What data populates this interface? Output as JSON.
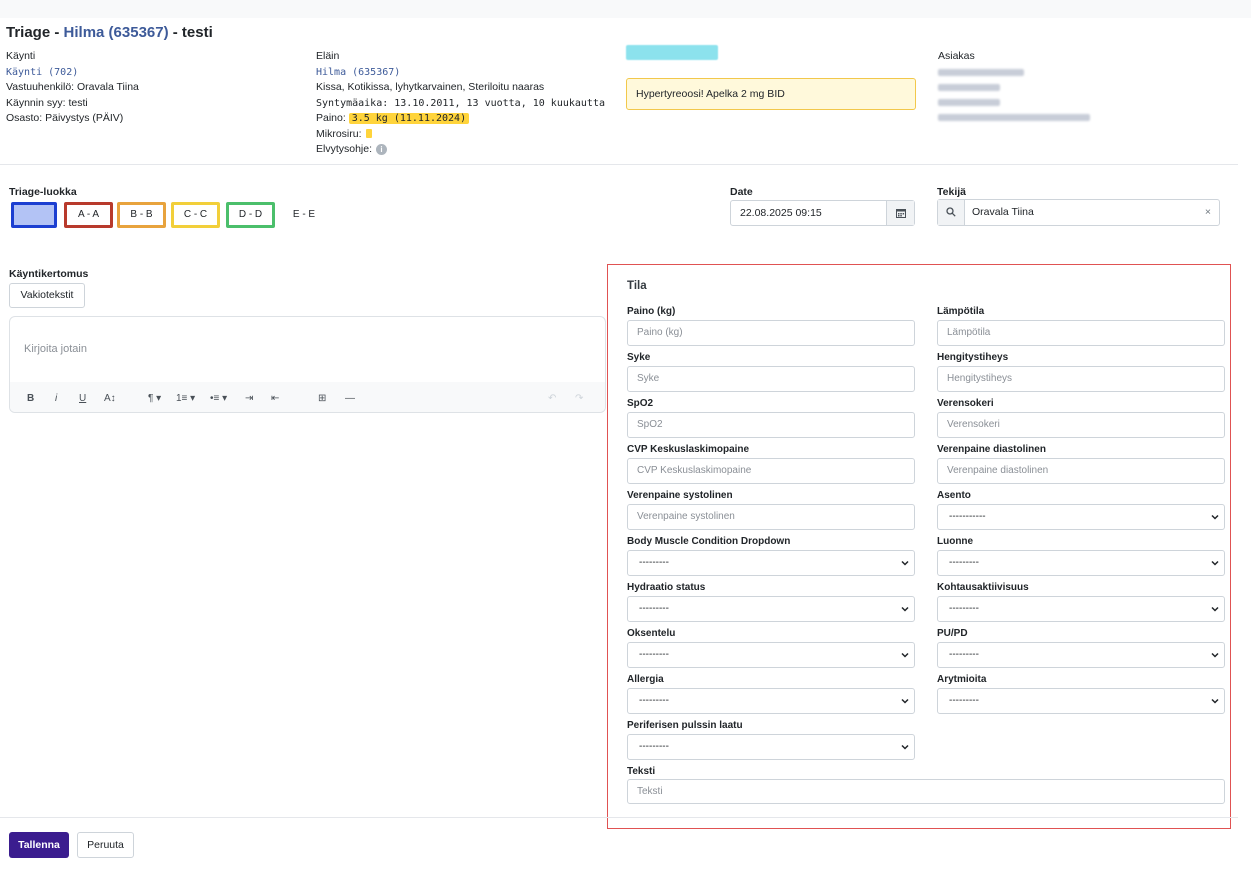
{
  "page": {
    "title_prefix": "Triage - ",
    "title_link": "Hilma (635367)",
    "title_suffix": " - testi"
  },
  "visit": {
    "heading": "Käynti",
    "link": "Käynti (702)",
    "responsible": "Vastuuhenkilö: Oravala Tiina",
    "reason": "Käynnin syy: testi",
    "department": "Osasto: Päivystys (PÄIV)"
  },
  "animal": {
    "heading": "Eläin",
    "link": "Hilma (635367)",
    "description": "Kissa, Kotikissa, lyhytkarvainen, Steriloitu naaras",
    "birthdate": "Syntymäaika: 13.10.2011, 13 vuotta, 10 kuukautta",
    "weight_label": "Paino:",
    "weight_value": "3.5 kg (11.11.2024)",
    "microchip_label": "Mikrosiru:",
    "resuscitation_label": "Elvytysohje:"
  },
  "alert": {
    "text": "Hypertyreoosi! Apelka 2 mg BID"
  },
  "customer": {
    "heading": "Asiakas"
  },
  "triage": {
    "label": "Triage-luokka",
    "options": [
      "",
      "A - A",
      "B - B",
      "C - C",
      "D - D",
      "E - E"
    ],
    "colors": [
      "#1c3fd1",
      "#b83a2c",
      "#e8a33d",
      "#f2cf3a",
      "#4bbf6b",
      "#ffffff"
    ]
  },
  "date": {
    "label": "Date",
    "value": "22.08.2025 09:15"
  },
  "author": {
    "label": "Tekijä",
    "value": "Oravala Tiina",
    "clear": "×"
  },
  "report": {
    "label": "Käyntikertomus",
    "standard_texts_button": "Vakiotekstit",
    "placeholder": "Kirjoita jotain"
  },
  "toolbar": {
    "bold": "B",
    "italic": "i",
    "underline": "U",
    "fontsize": "A↕",
    "paragraph": "¶ ▾",
    "ordered_list": "1≡ ▾",
    "bullet_list": "•≡ ▾",
    "indent": "⇥",
    "outdent": "⇤",
    "table": "⊞",
    "hr": "—",
    "undo": "↶",
    "redo": "↷"
  },
  "status_panel": {
    "title": "Tila",
    "fields": {
      "weight": {
        "label": "Paino (kg)",
        "placeholder": "Paino (kg)"
      },
      "temperature": {
        "label": "Lämpötila",
        "placeholder": "Lämpötila"
      },
      "pulse": {
        "label": "Syke",
        "placeholder": "Syke"
      },
      "resp_rate": {
        "label": "Hengitystiheys",
        "placeholder": "Hengitystiheys"
      },
      "spo2": {
        "label": "SpO2",
        "placeholder": "SpO2"
      },
      "blood_sugar": {
        "label": "Verensokeri",
        "placeholder": "Verensokeri"
      },
      "cvp": {
        "label": "CVP Keskuslaskimopaine",
        "placeholder": "CVP Keskuslaskimopaine"
      },
      "bp_diastolic": {
        "label": "Verenpaine diastolinen",
        "placeholder": "Verenpaine diastolinen"
      },
      "bp_systolic": {
        "label": "Verenpaine systolinen",
        "placeholder": "Verenpaine systolinen"
      },
      "position": {
        "label": "Asento",
        "value": "-----------"
      },
      "body_muscle": {
        "label": "Body Muscle Condition Dropdown",
        "value": "---------"
      },
      "temperament": {
        "label": "Luonne",
        "value": "---------"
      },
      "hydration": {
        "label": "Hydraatio status",
        "value": "---------"
      },
      "reception_activity": {
        "label": "Kohtausaktiivisuus",
        "value": "---------"
      },
      "vomiting": {
        "label": "Oksentelu",
        "value": "---------"
      },
      "pupd": {
        "label": "PU/PD",
        "value": "---------"
      },
      "allergy": {
        "label": "Allergia",
        "value": "---------"
      },
      "arrhythmias": {
        "label": "Arytmioita",
        "value": "---------"
      },
      "peripheral_pulse": {
        "label": "Periferisen pulssin laatu",
        "value": "---------"
      },
      "text": {
        "label": "Teksti",
        "placeholder": "Teksti"
      }
    }
  },
  "footer": {
    "save": "Tallenna",
    "cancel": "Peruuta"
  }
}
